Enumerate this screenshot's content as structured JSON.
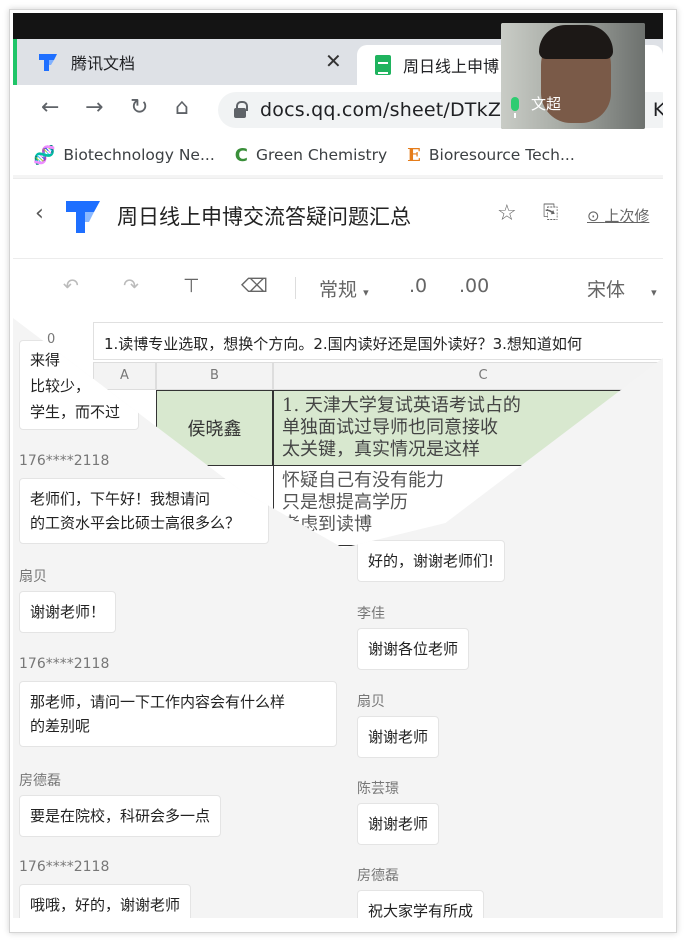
{
  "browser": {
    "tabs": [
      {
        "title": "腾讯文档"
      },
      {
        "title": "周日线上申博"
      }
    ],
    "url": "docs.qq.com/sheet/DTkZY",
    "url_tail": "K?",
    "bookmarks": [
      {
        "label": "Biotechnology Ne...",
        "icon": "🧬"
      },
      {
        "label": "Green Chemistry",
        "icon": "C"
      },
      {
        "label": "Bioresource Tech...",
        "icon": "E"
      }
    ]
  },
  "document": {
    "title": "周日线上申博交流答疑问题汇总",
    "last_edit": "上次修",
    "toolbar": {
      "format": "常规",
      "decimal_decrease": ".0",
      "decimal_increase": ".00",
      "font": "宋体"
    },
    "formula_bar": "1.读博专业选取，想换个方向。2.国内读好还是国外读好？3.想知道如何",
    "cell_ref": "0",
    "columns": [
      "A",
      "B",
      "C"
    ],
    "row_name": "侯晓鑫",
    "row_text_1": "1. 天津大学复试英语考试占的",
    "row_text_2": "单独面试过导师也同意接收",
    "row_text_3": "太关键，真实情况是这样",
    "row2_text_1": "怀疑自己有没有能力",
    "row2_text_2": "只是想提高学历",
    "row2_text_3": "考虑到读博"
  },
  "chat_left": {
    "partial_lines": [
      "来得",
      "比较少，",
      "学生，而不过"
    ],
    "messages": [
      {
        "sender": "176****2118",
        "text": [
          "老师们，下午好！我想请问",
          "的工资水平会比硕士高很多么？"
        ]
      },
      {
        "sender": "扇贝",
        "text": [
          "谢谢老师！"
        ]
      },
      {
        "sender": "176****2118",
        "text": [
          "那老师，请问一下工作内容会有什么样",
          "的差别呢"
        ]
      },
      {
        "sender": "房德磊",
        "text": [
          "要是在院校，科研会多一点"
        ]
      },
      {
        "sender": "176****2118",
        "text": [
          "哦哦，好的，谢谢老师"
        ]
      }
    ]
  },
  "chat_right": {
    "messages": [
      {
        "sender": "",
        "text": "好的，谢谢老师们!"
      },
      {
        "sender": "李佳",
        "text": "谢谢各位老师"
      },
      {
        "sender": "扇贝",
        "text": "谢谢老师"
      },
      {
        "sender": "陈芸璟",
        "text": "谢谢老师"
      },
      {
        "sender": "房德磊",
        "text": "祝大家学有所成"
      }
    ]
  },
  "video": {
    "name": "文超"
  },
  "colors": {
    "brand_green": "#1fc568",
    "cell_green": "#d8e8cf",
    "tencent_blue": "#1e6fff"
  }
}
